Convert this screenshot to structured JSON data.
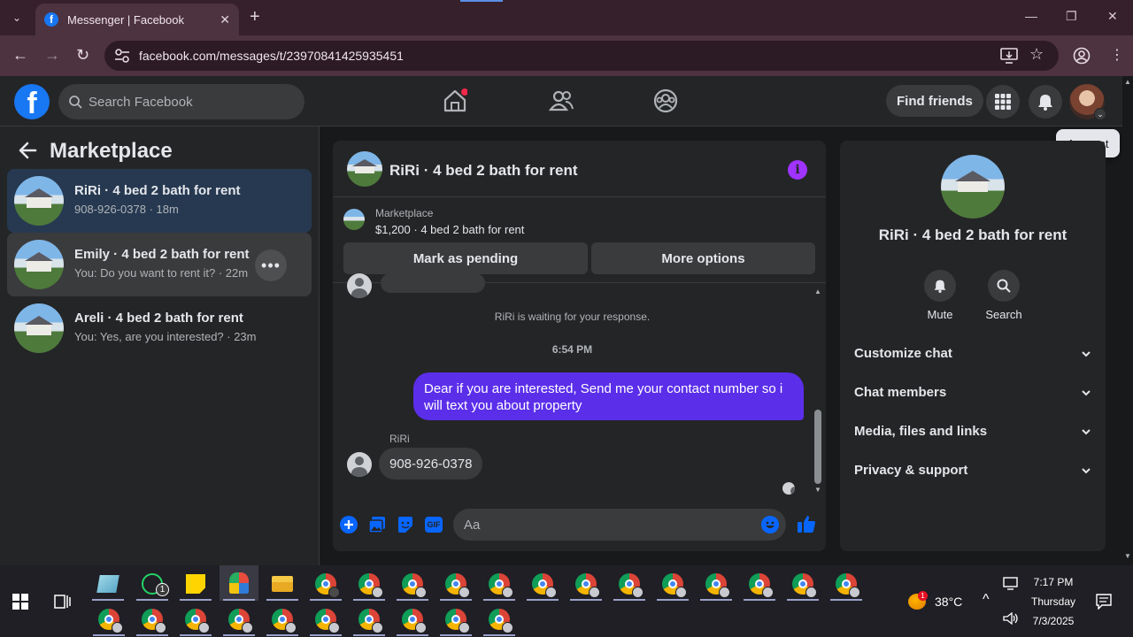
{
  "browser": {
    "tab_title": "Messenger | Facebook",
    "url": "facebook.com/messages/t/23970841425935451"
  },
  "fb": {
    "search_placeholder": "Search Facebook",
    "find_friends": "Find friends",
    "tooltip": "Account"
  },
  "sidebar": {
    "title": "Marketplace",
    "conversations": [
      {
        "title": "RiRi · 4 bed 2 bath for rent",
        "subtitle": "908-926-0378 · 18m"
      },
      {
        "title": "Emily · 4 bed 2 bath for rent",
        "subtitle": "You: Do you want to rent it? · 22m"
      },
      {
        "title": "Areli · 4 bed 2 bath for rent",
        "subtitle": "You: Yes, are you interested? · 23m"
      }
    ],
    "more_glyph": "•••"
  },
  "chat": {
    "name": "RiRi · 4 bed 2 bath for rent",
    "info_glyph": "i",
    "card_label": "Marketplace",
    "card_price": "$1,200 · 4 bed 2 bath for rent",
    "btn_pending": "Mark as pending",
    "btn_more": "More options",
    "system_msg": "RiRi is waiting for your response.",
    "timestamp": "6:54 PM",
    "outgoing": "Dear if you are interested, Send me your contact number so i will text you about property",
    "sender": "RiRi",
    "incoming": "908-926-0378",
    "composer_placeholder": "Aa",
    "accent": "#5b2eea"
  },
  "rpanel": {
    "name": "RiRi · 4 bed 2 bath for rent",
    "mute": "Mute",
    "search": "Search",
    "sections": [
      "Customize chat",
      "Chat members",
      "Media, files and links",
      "Privacy & support"
    ]
  },
  "taskbar": {
    "time": "7:17 PM",
    "day": "Thursday",
    "date": "7/3/2025",
    "temp": "38°C",
    "whatsapp_badge": "1",
    "weather_badge": "1"
  }
}
